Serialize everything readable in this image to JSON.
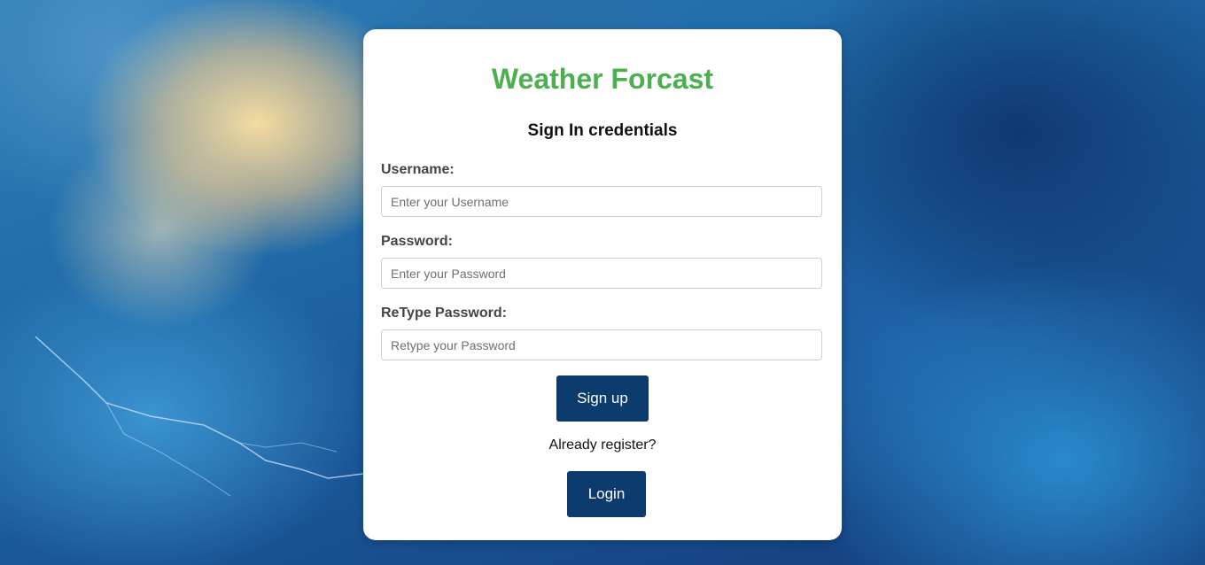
{
  "page": {
    "title": "Weather Forcast",
    "subtitle": "Sign In credentials",
    "accent_color": "#4caf50",
    "button_color": "#0c3b6e"
  },
  "form": {
    "username": {
      "label": "Username:",
      "placeholder": "Enter your Username",
      "value": ""
    },
    "password": {
      "label": "Password:",
      "placeholder": "Enter your Password",
      "value": ""
    },
    "retype_password": {
      "label": "ReType Password:",
      "placeholder": "Retype your Password",
      "value": ""
    },
    "signup_label": "Sign up",
    "already_text": "Already register?",
    "login_label": "Login"
  }
}
